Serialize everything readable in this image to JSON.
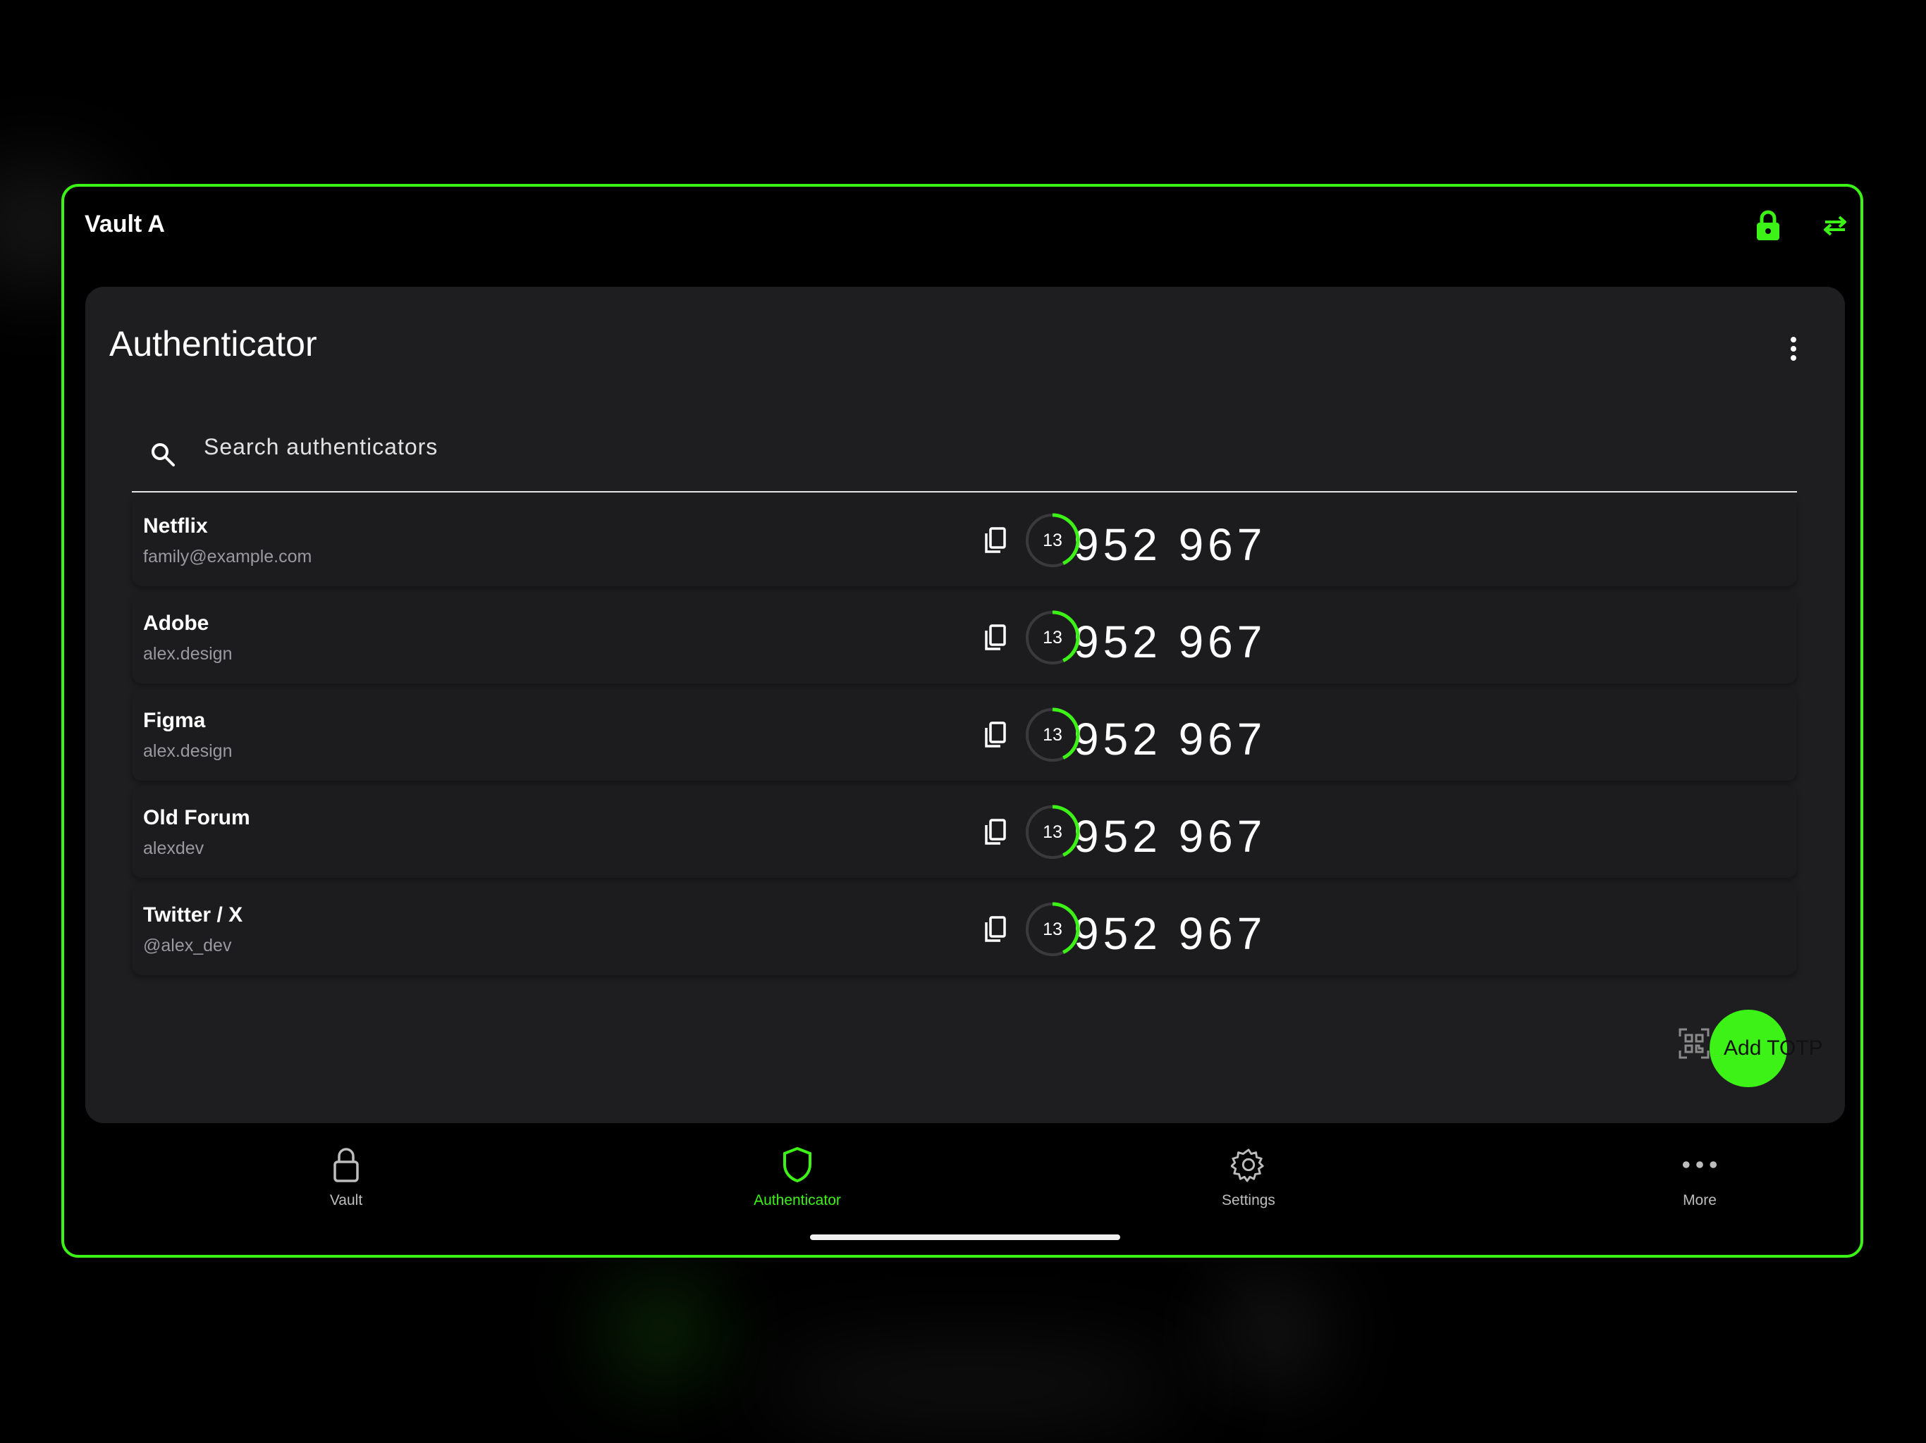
{
  "colors": {
    "accent": "#3df216",
    "background": "#000000",
    "card": "#1e1e20",
    "muted_text": "#9a9a9e"
  },
  "topbar": {
    "title": "Vault A",
    "lock_icon": "lock-icon",
    "switch_icon": "swap-arrows-icon"
  },
  "card": {
    "title": "Authenticator",
    "menu_icon": "more-vertical-icon"
  },
  "search": {
    "placeholder": "Search authenticators",
    "value": ""
  },
  "entries": [
    {
      "name": "Netflix",
      "account": "family@example.com",
      "code": "952 967",
      "seconds_left": "13",
      "progress": 0.43
    },
    {
      "name": "Adobe",
      "account": "alex.design",
      "code": "952 967",
      "seconds_left": "13",
      "progress": 0.43
    },
    {
      "name": "Figma",
      "account": "alex.design",
      "code": "952 967",
      "seconds_left": "13",
      "progress": 0.43
    },
    {
      "name": "Old Forum",
      "account": "alexdev",
      "code": "952 967",
      "seconds_left": "13",
      "progress": 0.43
    },
    {
      "name": "Twitter / X",
      "account": "@alex_dev",
      "code": "952 967",
      "seconds_left": "13",
      "progress": 0.43
    }
  ],
  "fab": {
    "label": "Add TOTP",
    "icon": "qr-scan-icon"
  },
  "nav": [
    {
      "label": "Vault",
      "icon": "lock-outline-icon",
      "active": false
    },
    {
      "label": "Authenticator",
      "icon": "shield-icon",
      "active": true
    },
    {
      "label": "Settings",
      "icon": "gear-icon",
      "active": false
    },
    {
      "label": "More",
      "icon": "more-horizontal-icon",
      "active": false
    }
  ]
}
